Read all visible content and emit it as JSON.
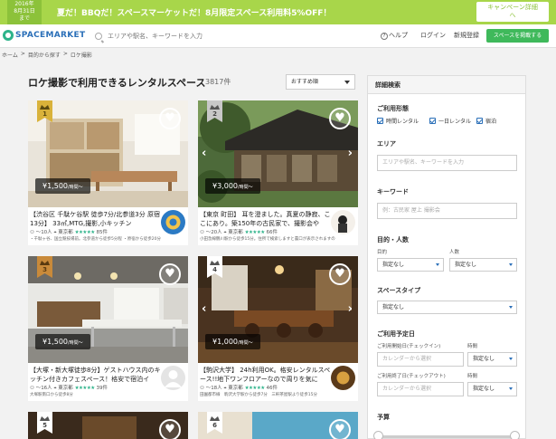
{
  "promo": {
    "date_line1": "2016年",
    "date_line2": "8月31日",
    "date_line3": "まで",
    "text": "夏だ！BBQだ！スペースマーケットだ！8月限定スペース利用料5%OFF！",
    "button_line1": "キャンペーン詳細",
    "button_line2": "へ"
  },
  "header": {
    "logo": "SPACEMARKET",
    "search_placeholder": "エリアや駅名、キーワードを入力",
    "help": "ヘルプ",
    "login": "ログイン",
    "signup": "新規登録",
    "list_space": "スペースを掲載する"
  },
  "breadcrumb": [
    "ホーム",
    ">",
    "目的から探す",
    ">",
    "ロケ撮影"
  ],
  "main": {
    "title": "ロケ撮影で利用できるレンタルスペース",
    "count": "3817件",
    "sort": "おすすめ順"
  },
  "cards": [
    {
      "rank": "1",
      "price": "¥1,500",
      "unit": "/時間〜",
      "title": "【渋谷区 千駄ケ谷駅 徒歩7分/北参道3分 原宿13分】 33㎡,MTG,撮影,小キッチン",
      "capacity": "〜10人",
      "area": "東京都",
      "stars": "★★★★★",
      "reviews": "85件",
      "desc": "・千駄ヶ谷、国立競技場前。北参道から徒歩5分程 ・原宿から徒歩20分"
    },
    {
      "rank": "2",
      "price": "¥3,000",
      "unit": "/時間〜",
      "title": "【東京 町田】 耳を澄ました。真夏の静寂、ここにあり。築150年の古民家で、撮影会や",
      "capacity": "〜20人",
      "area": "東京都",
      "stars": "★★★★★",
      "reviews": "66件",
      "desc": "小田急線鶴川駅から徒歩15分。住所で検索しますと農口が表示されますの"
    },
    {
      "rank": "3",
      "price": "¥1,500",
      "unit": "/時間〜",
      "title": "【大塚・新大塚徒歩8分】ゲストハウス内のキッチン付きカフェスペース！格安で宿泊イ",
      "capacity": "〜16人",
      "area": "東京都",
      "stars": "★★★★★",
      "reviews": "39件",
      "desc": "大塚駅南口から徒歩8分"
    },
    {
      "rank": "4",
      "price": "¥1,000",
      "unit": "/時間〜",
      "title": "【駒沢大学】 24h利用OK。格安レンタルスペース!!地下ワンフロアーなので周りを気に",
      "capacity": "〜18人",
      "area": "東京都",
      "stars": "★★★★★",
      "reviews": "46件",
      "desc": "田園都市線　駒沢大学駅から徒歩7分　三軒茶屋駅より徒歩15分"
    },
    {
      "rank": "5"
    },
    {
      "rank": "6"
    }
  ],
  "sidebar": {
    "header": "詳細検索",
    "usage_label": "ご利用形態",
    "usage_options": [
      "時間レンタル",
      "一日レンタル",
      "宿泊"
    ],
    "area_label": "エリア",
    "area_placeholder": "エリアや駅名、キーワードを入力",
    "keyword_label": "キーワード",
    "keyword_placeholder": "例：古民家 屋上 撮影会",
    "purpose_label": "目的・人数",
    "purpose_sub": "目的",
    "people_sub": "人数",
    "unspecified": "指定なし",
    "type_label": "スペースタイプ",
    "date_label": "ご利用予定日",
    "checkin_label": "ご利用開始日(チェックイン)",
    "checkout_label": "ご利用終了日(チェックアウト)",
    "time_label": "時間",
    "calendar_placeholder": "カレンダーから選択",
    "budget_label": "予算"
  }
}
